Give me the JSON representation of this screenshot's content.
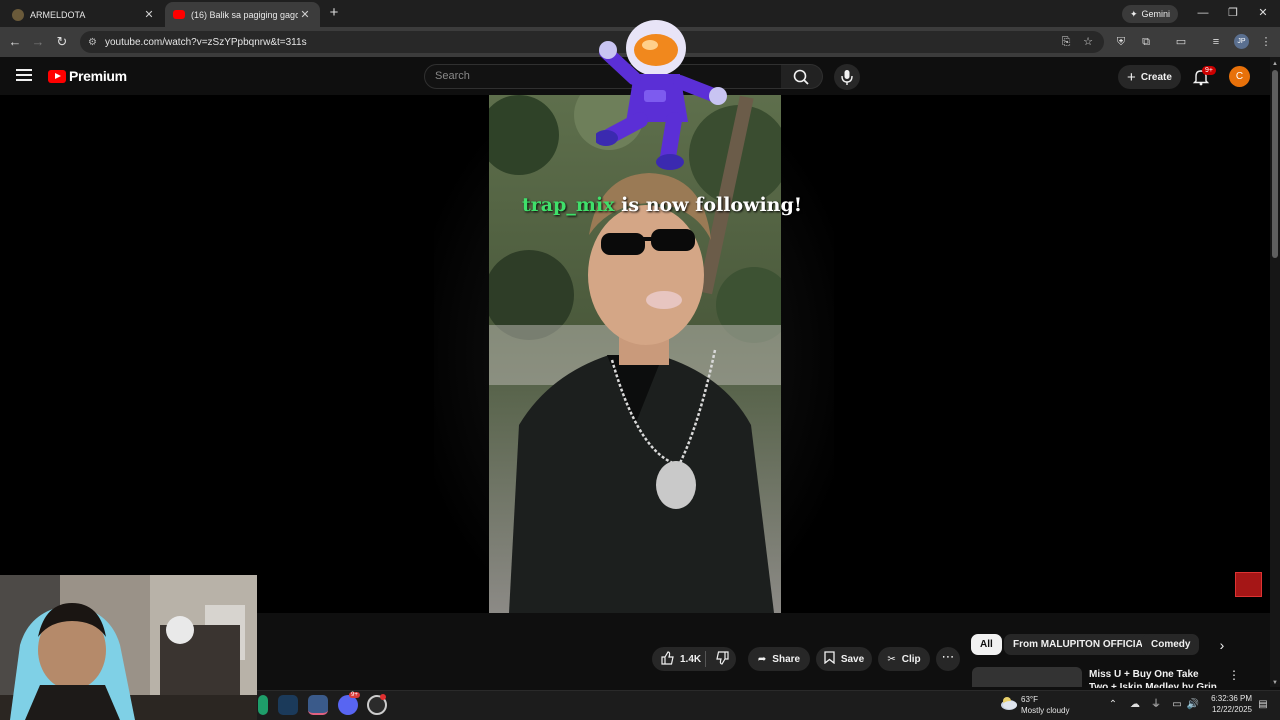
{
  "browser": {
    "tabs": [
      {
        "title": "ARMELDOTA",
        "active": false
      },
      {
        "title": "(16) Balik sa pagiging gago Part",
        "active": true
      }
    ],
    "new_tab_icon": "plus-icon",
    "gemini_label": "Gemini",
    "url": "youtube.com/watch?v=zSzYPpbqnrw&t=311s",
    "profile_initials": "JP"
  },
  "youtube": {
    "logo_text": "Premium",
    "search_placeholder": "Search",
    "create_label": "Create",
    "notifications_badge": "9+",
    "avatar_letter": "C",
    "brand_color": "#ff0000"
  },
  "video": {
    "overlay_username": "trap_mix",
    "overlay_text": " is now following!",
    "overlay_username_color": "#3fe06a"
  },
  "actions": {
    "like_count": "1.4K",
    "share_label": "Share",
    "save_label": "Save",
    "clip_label": "Clip",
    "more_label": "⋯"
  },
  "chips": [
    {
      "label": "All",
      "selected": true
    },
    {
      "label": "From MALUPITON OFFICIAL",
      "selected": false
    },
    {
      "label": "Comedy",
      "selected": false
    }
  ],
  "recommendation": {
    "title": "Miss U + Buy One Take Two + Iskin Medley by Grin"
  },
  "taskbar": {
    "weather_temp": "63°F",
    "weather_desc": "Mostly cloudy",
    "time": "6:32:36 PM",
    "date": "12/22/2025",
    "discord_badge": "9+"
  }
}
